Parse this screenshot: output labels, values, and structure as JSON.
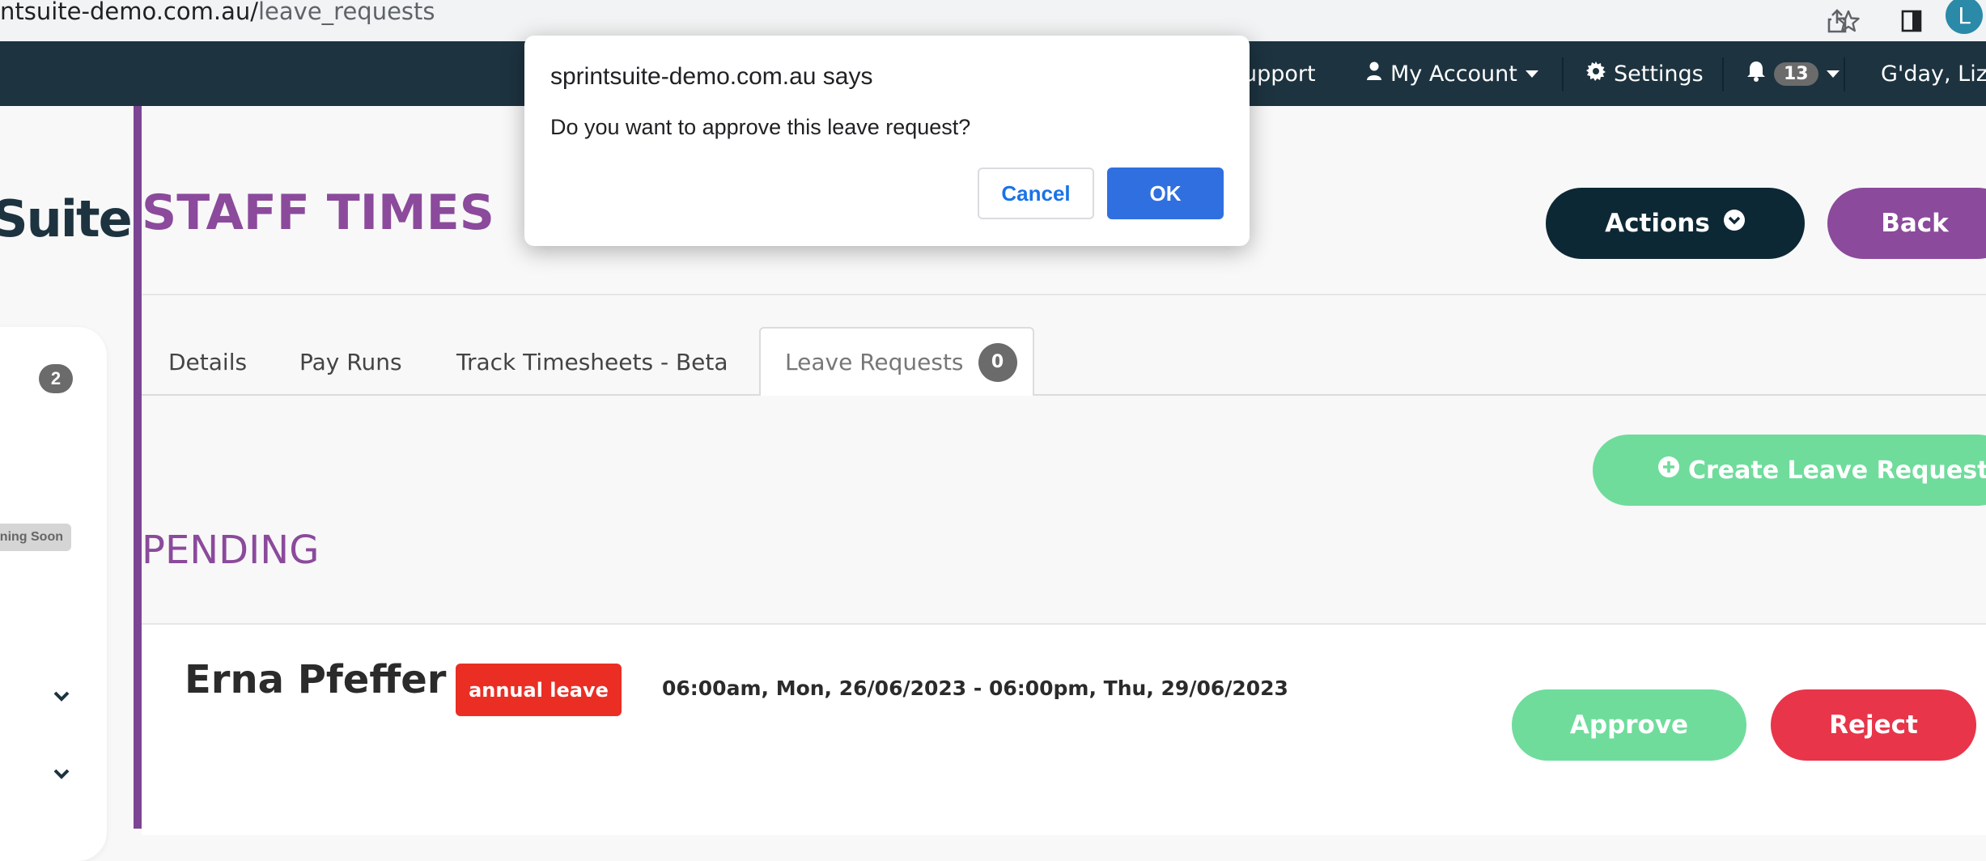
{
  "browser": {
    "url_host": "ntsuite-demo.com.au/",
    "url_path": "leave_requests",
    "avatar_letter": "L",
    "icons": [
      "share-icon",
      "star-icon",
      "sidebar-toggle-icon"
    ]
  },
  "navbar": {
    "support": "upport",
    "my_account": "My Account",
    "settings": "Settings",
    "notifications_count": "13",
    "greeting": "G'day, Liz",
    "bg_color": "#1d3340"
  },
  "sidebar": {
    "logo_text": "Suite",
    "badge_count": "2",
    "coming_soon": "ning Soon"
  },
  "header": {
    "title": "STAFF TIMES",
    "actions_label": "Actions",
    "back_label": "Back"
  },
  "tabs": [
    {
      "label": "Details"
    },
    {
      "label": "Pay Runs"
    },
    {
      "label": "Track Timesheets - Beta"
    },
    {
      "label": "Leave Requests",
      "count": "0",
      "active": true
    }
  ],
  "main": {
    "create_label": "Create Leave Request",
    "section_title": "PENDING"
  },
  "leave_requests": [
    {
      "employee": "Erna Pfeffer",
      "type": "annual leave",
      "dates": "06:00am, Mon, 26/06/2023 - 06:00pm, Thu, 29/06/2023",
      "approve_label": "Approve",
      "reject_label": "Reject"
    }
  ],
  "dialog": {
    "title": "sprintsuite-demo.com.au says",
    "message": "Do you want to approve this leave request?",
    "cancel_label": "Cancel",
    "ok_label": "OK"
  },
  "colors": {
    "brand_purple": "#8b4a9c",
    "dark_navy": "#0d2835",
    "green": "#6fdc9c",
    "red": "#e8354a",
    "leave_badge_red": "#ea2e24",
    "dialog_ok_blue": "#2f6fe0"
  }
}
